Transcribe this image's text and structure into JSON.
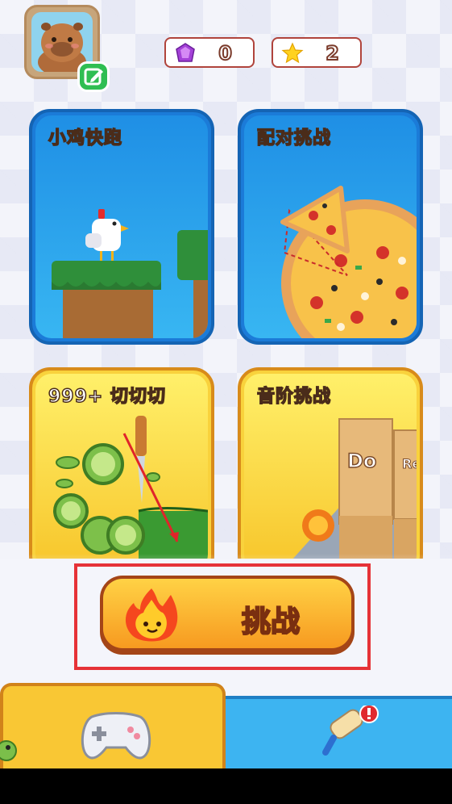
{
  "header": {
    "gems": "0",
    "stars": "2"
  },
  "cards": [
    {
      "title": "小鸡快跑"
    },
    {
      "title": "配对挑战"
    },
    {
      "title": "999+ 切切切"
    },
    {
      "title": "音阶挑战",
      "notes": [
        "Do",
        "Re"
      ]
    }
  ],
  "challenge": {
    "label": "挑战"
  },
  "colors": {
    "accent": "#f79a20",
    "highlight": "#e63237",
    "nav_active": "#f9c734",
    "nav_inactive": "#3db4f1"
  }
}
